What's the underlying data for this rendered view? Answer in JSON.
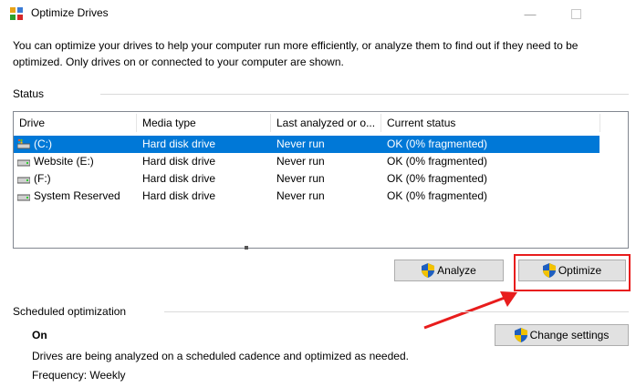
{
  "window": {
    "title": "Optimize Drives"
  },
  "description": "You can optimize your drives to help your computer run more efficiently, or analyze them to find out if they need to be optimized. Only drives on or connected to your computer are shown.",
  "status": {
    "label": "Status",
    "columns": [
      "Drive",
      "Media type",
      "Last analyzed or o...",
      "Current status"
    ],
    "drives": [
      {
        "name": "(C:)",
        "media": "Hard disk drive",
        "last": "Never run",
        "status": "OK (0% fragmented)",
        "icon": "system-drive-icon",
        "selected": true
      },
      {
        "name": "Website (E:)",
        "media": "Hard disk drive",
        "last": "Never run",
        "status": "OK (0% fragmented)",
        "icon": "drive-icon",
        "selected": false
      },
      {
        "name": "(F:)",
        "media": "Hard disk drive",
        "last": "Never run",
        "status": "OK (0% fragmented)",
        "icon": "drive-icon",
        "selected": false
      },
      {
        "name": "System Reserved",
        "media": "Hard disk drive",
        "last": "Never run",
        "status": "OK (0% fragmented)",
        "icon": "drive-icon",
        "selected": false
      }
    ]
  },
  "buttons": {
    "analyze": "Analyze",
    "optimize": "Optimize",
    "change_settings": "Change settings"
  },
  "scheduled": {
    "label": "Scheduled optimization",
    "state": "On",
    "detail": "Drives are being analyzed on a scheduled cadence and optimized as needed.",
    "frequency": "Frequency: Weekly"
  },
  "colors": {
    "selection": "#0078d7",
    "highlight": "#e81c1c",
    "button_face": "#e1e1e1"
  }
}
